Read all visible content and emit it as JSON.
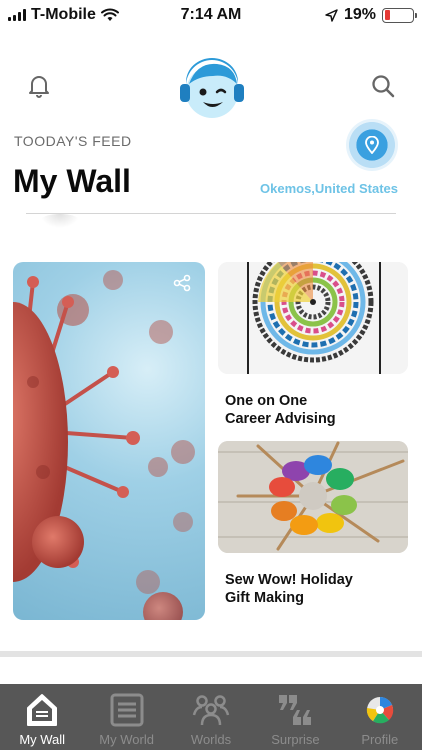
{
  "status_bar": {
    "carrier": "T-Mobile",
    "time": "7:14 AM",
    "battery": "19%",
    "battery_level": 0.19
  },
  "header": {
    "feed_label": "TOODAY'S FEED",
    "title": "My Wall",
    "location": "Okemos,United States",
    "icons": [
      "bell-icon",
      "logo-avatar",
      "search-icon",
      "location-pin-icon"
    ]
  },
  "cards": [
    {
      "image": "virus-illustration",
      "title": ""
    },
    {
      "image": "color-wheel",
      "title_lines": [
        "One on One",
        "Career Advising"
      ]
    },
    {
      "image": "paint-palette",
      "title_lines": [
        "Sew Wow! Holiday",
        "Gift Making"
      ]
    }
  ],
  "tabs": [
    {
      "label": "My Wall",
      "icon": "home-icon",
      "active": true
    },
    {
      "label": "My World",
      "icon": "list-icon",
      "active": false
    },
    {
      "label": "Worlds",
      "icon": "people-icon",
      "active": false
    },
    {
      "label": "Surprise",
      "icon": "quote-icon",
      "active": false
    },
    {
      "label": "Profile",
      "icon": "profile-icon",
      "active": false
    }
  ],
  "colors": {
    "accent": "#6ec3e6",
    "pin": "#3aa0e0",
    "tab_bar": "#575757",
    "battery_low": "#e53935"
  }
}
